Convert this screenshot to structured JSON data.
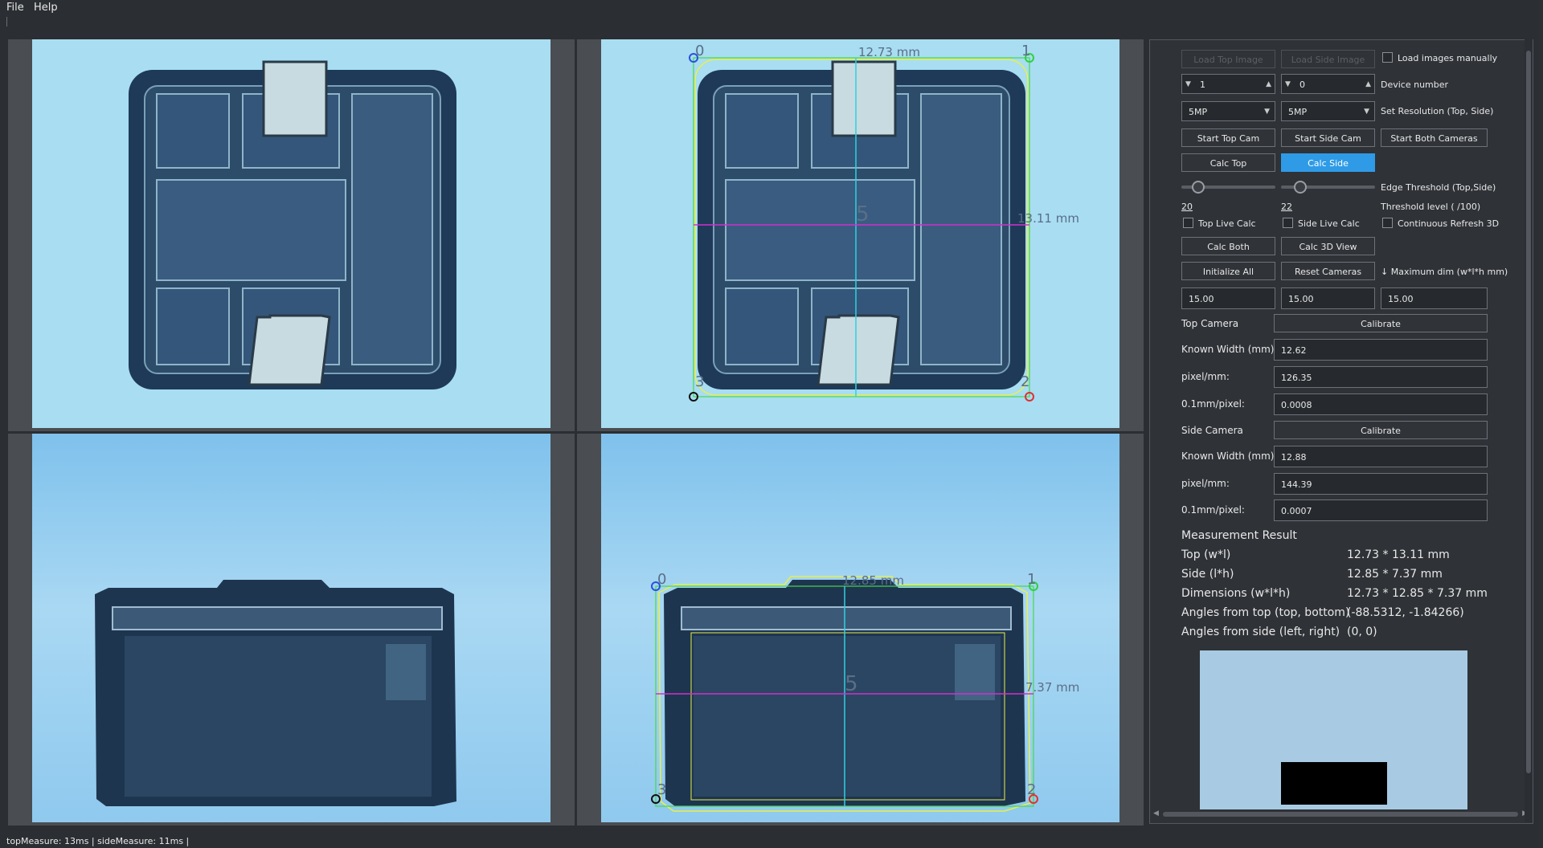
{
  "menu": {
    "file": "File",
    "help": "Help"
  },
  "views": {
    "top_overlay": {
      "width_label": "12.73 mm",
      "length_label": "13.11 mm",
      "center_label": "5",
      "corners": [
        "0",
        "1",
        "2",
        "3"
      ]
    },
    "side_overlay": {
      "width_label": "12.85 mm",
      "height_label": "7.37 mm",
      "center_label": "5",
      "corners": [
        "0",
        "1",
        "2",
        "3"
      ]
    }
  },
  "controls": {
    "load_top_image": "Load Top Image",
    "load_side_image": "Load Side Image",
    "load_manually": "Load images manually",
    "device_top": "1",
    "device_side": "0",
    "device_number": "Device number",
    "res_top": "5MP",
    "res_side": "5MP",
    "set_resolution": "Set Resolution (Top, Side)",
    "start_top": "Start Top Cam",
    "start_side": "Start Side Cam",
    "start_both": "Start Both Cameras",
    "calc_top": "Calc Top",
    "calc_side": "Calc Side",
    "edge_threshold": "Edge Threshold (Top,Side)",
    "threshold_top": "20",
    "threshold_side": "22",
    "threshold_level": "Threshold level ( /100)",
    "top_live": "Top Live Calc",
    "side_live": "Side Live Calc",
    "continuous_3d": "Continuous Refresh 3D",
    "calc_both": "Calc Both",
    "calc_3d": "Calc 3D View",
    "initialize_all": "Initialize All",
    "reset_cameras": "Reset Cameras",
    "max_dim_label": "↓ Maximum dim (w*l*h mm)",
    "max_w": "15.00",
    "max_l": "15.00",
    "max_h": "15.00",
    "top_camera": "Top Camera",
    "calibrate": "Calibrate",
    "known_width": "Known Width (mm)",
    "pixel_mm": "pixel/mm:",
    "mm_pixel": "0.1mm/pixel:",
    "top_known_width": "12.62",
    "top_pixel_mm": "126.35",
    "top_mm_pixel": "0.0008",
    "side_camera": "Side Camera",
    "side_known_width": "12.88",
    "side_pixel_mm": "144.39",
    "side_mm_pixel": "0.0007"
  },
  "results": {
    "title": "Measurement Result",
    "rows": [
      {
        "label": "Top (w*l)",
        "value": "12.73 * 13.11 mm"
      },
      {
        "label": "Side (l*h)",
        "value": "12.85 * 7.37 mm"
      },
      {
        "label": "Dimensions (w*l*h)",
        "value": "12.73 * 12.85 * 7.37 mm"
      },
      {
        "label": "Angles from top (top, bottom)",
        "value": "(-88.5312, -1.84266)"
      },
      {
        "label": "Angles from side (left, right)",
        "value": "(0, 0)"
      }
    ]
  },
  "status": "topMeasure: 13ms | sideMeasure: 11ms |",
  "colors": {
    "accent": "#2f9be6",
    "panel": "#2f3237",
    "measure_line": "#d030d0",
    "center_line": "#30d0e0",
    "contour": "#e8f04a"
  }
}
